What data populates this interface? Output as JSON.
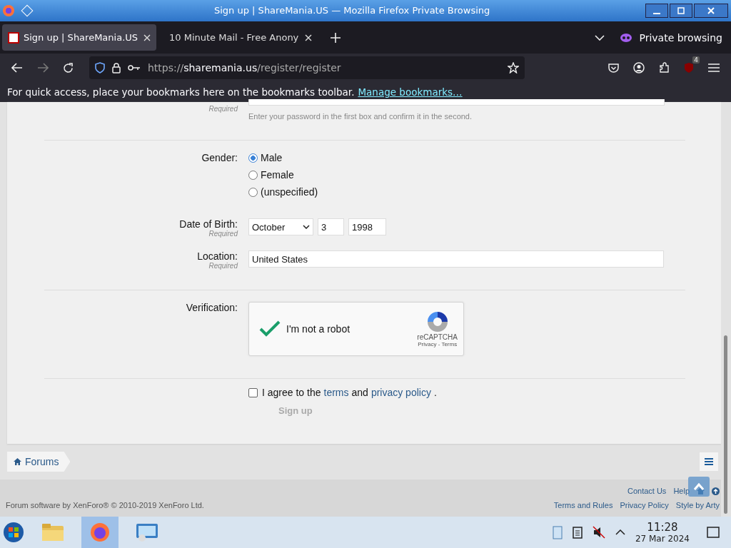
{
  "window": {
    "title": "Sign up | ShareMania.US — Mozilla Firefox Private Browsing"
  },
  "tabs": [
    {
      "label": "Sign up | ShareMania.US",
      "selected": true
    },
    {
      "label": "10 Minute Mail - Free Anony",
      "selected": false
    }
  ],
  "private_label": "Private browsing",
  "address": {
    "scheme": "https://",
    "host": "sharemania.us",
    "path": "/register/register"
  },
  "extension_badge": "4",
  "bookmarks_bar": {
    "text": "For quick access, place your bookmarks here on the bookmarks toolbar.",
    "link": "Manage bookmarks…"
  },
  "form": {
    "password_required": "Required",
    "password_hint": "Enter your password in the first box and confirm it in the second.",
    "gender": {
      "label": "Gender:",
      "options": [
        {
          "label": "Male",
          "selected": true
        },
        {
          "label": "Female",
          "selected": false
        },
        {
          "label": "(unspecified)",
          "selected": false
        }
      ]
    },
    "dob": {
      "label": "Date of Birth:",
      "required": "Required",
      "month": "October",
      "day": "3",
      "year": "1998"
    },
    "location": {
      "label": "Location:",
      "required": "Required",
      "value": "United States"
    },
    "verification": {
      "label": "Verification:",
      "checked": true,
      "text": "I'm not a robot",
      "brand": "reCAPTCHA",
      "privacy": "Privacy",
      "separator": "-",
      "terms": "Terms"
    },
    "agree": {
      "checked": false,
      "before": "I agree to the",
      "terms": "terms",
      "middle": "and",
      "privacy": "privacy policy",
      "after": "."
    },
    "submit": {
      "label": "Sign up",
      "disabled": true
    }
  },
  "breadcrumb": "Forums",
  "footer": {
    "copyright": "Forum software by XenForo® © 2010-2019 XenForo Ltd.",
    "links_top": [
      "Contact Us",
      "Help"
    ],
    "links_bottom": [
      "Terms and Rules",
      "Privacy Policy",
      "Style by Arty"
    ]
  },
  "taskbar": {
    "time": "11:28",
    "date": "27 Mar 2024"
  }
}
